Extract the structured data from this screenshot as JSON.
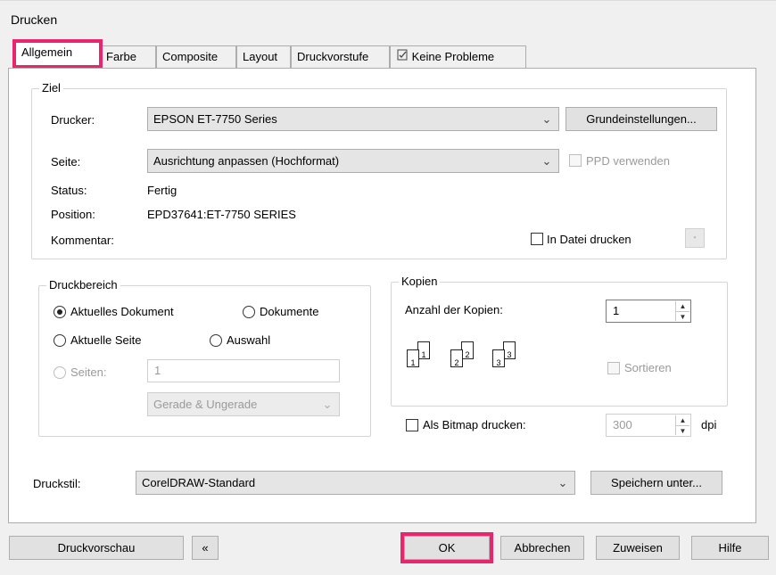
{
  "window": {
    "title": "Drucken"
  },
  "tabs": [
    {
      "label": "Allgemein"
    },
    {
      "label": "Farbe"
    },
    {
      "label": "Composite"
    },
    {
      "label": "Layout"
    },
    {
      "label": "Druckvorstufe"
    },
    {
      "label": "Keine Probleme",
      "icon": "check-clipboard-icon"
    }
  ],
  "ziel": {
    "title": "Ziel",
    "printer_label": "Drucker:",
    "printer_value": "EPSON ET-7750 Series",
    "page_label": "Seite:",
    "page_value": "Ausrichtung anpassen (Hochformat)",
    "setup_button": "Grundeinstellungen...",
    "ppd_label": "PPD verwenden",
    "status_label": "Status:",
    "status_value": "Fertig",
    "position_label": "Position:",
    "position_value": "EPD37641:ET-7750 SERIES",
    "comment_label": "Kommentar:",
    "print_to_file_label": "In Datei drucken"
  },
  "range": {
    "title": "Druckbereich",
    "current_document": "Aktuelles Dokument",
    "documents": "Dokumente",
    "current_page": "Aktuelle Seite",
    "selection": "Auswahl",
    "pages_label": "Seiten:",
    "pages_value": "1",
    "even_odd": "Gerade & Ungerade"
  },
  "copies": {
    "title": "Kopien",
    "count_label": "Anzahl der Kopien:",
    "count_value": "1",
    "collate_label": "Sortieren",
    "page_numbers": [
      "1",
      "1",
      "2",
      "2",
      "3",
      "3"
    ]
  },
  "bitmap": {
    "label": "Als Bitmap drucken:",
    "dpi_value": "300",
    "dpi_unit": "dpi"
  },
  "style": {
    "label": "Druckstil:",
    "value": "CorelDRAW-Standard",
    "save_as": "Speichern unter..."
  },
  "footer": {
    "preview": "Druckvorschau",
    "collapse_icon": "«",
    "ok": "OK",
    "cancel": "Abbrechen",
    "apply": "Zuweisen",
    "help": "Hilfe"
  },
  "colors": {
    "highlight": "#e8256d"
  }
}
